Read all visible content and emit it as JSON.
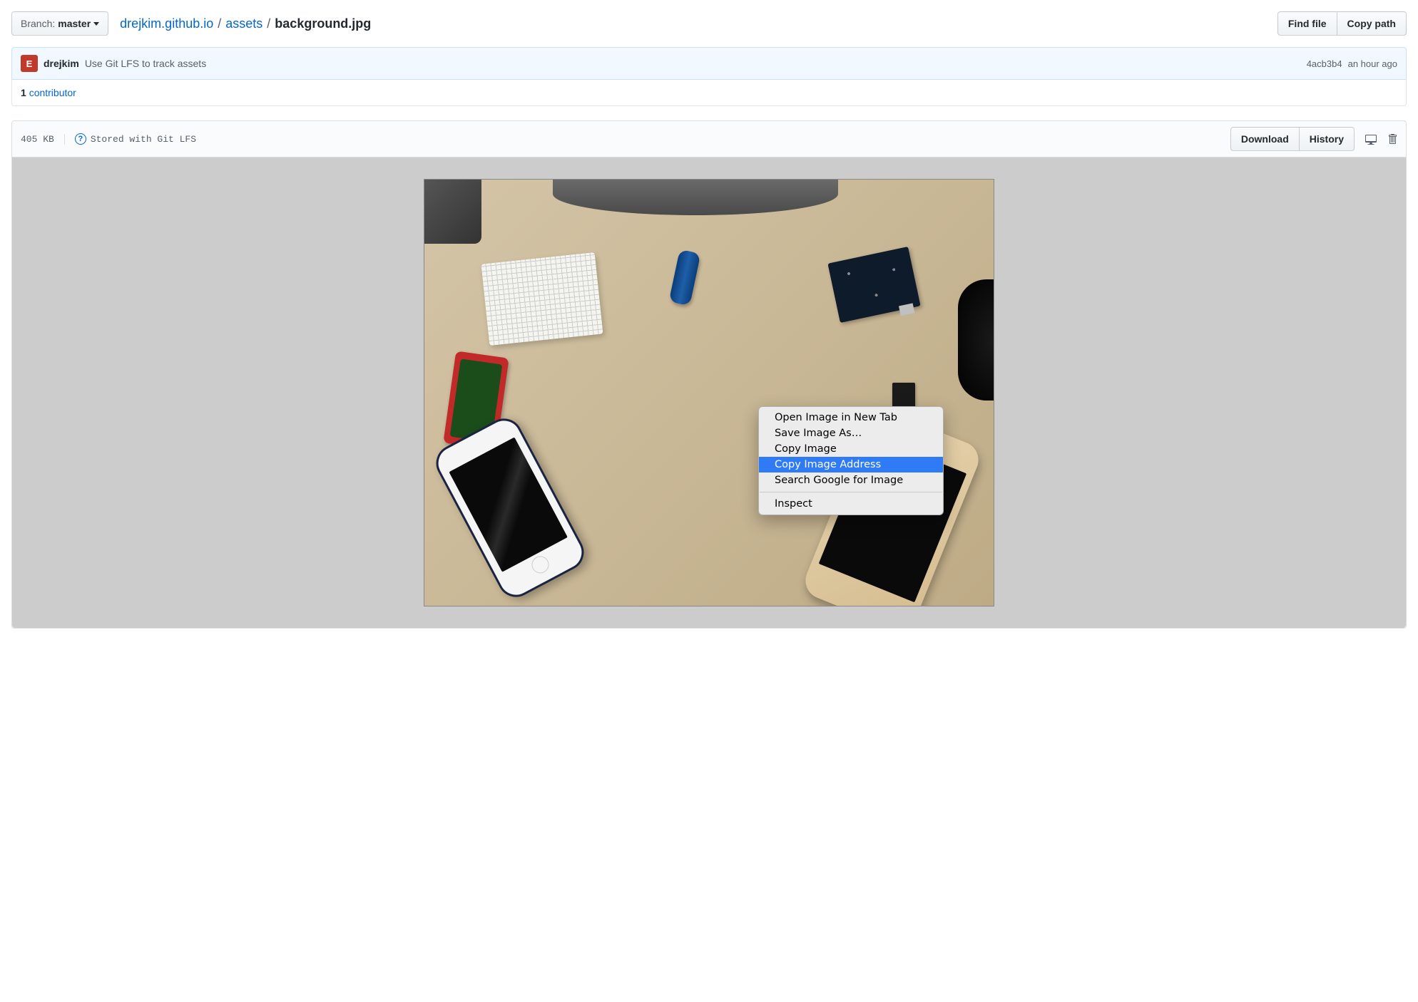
{
  "branch": {
    "label": "Branch:",
    "name": "master"
  },
  "breadcrumb": {
    "repo": "drejkim.github.io",
    "folder": "assets",
    "file": "background.jpg"
  },
  "actions": {
    "find_file": "Find file",
    "copy_path": "Copy path"
  },
  "commit": {
    "avatar_letter": "E",
    "author": "drejkim",
    "message": "Use Git LFS to track assets",
    "sha": "4acb3b4",
    "time": "an hour ago"
  },
  "contributors": {
    "count": "1",
    "label": "contributor"
  },
  "file": {
    "size": "405 KB",
    "lfs_text": "Stored with Git LFS",
    "download": "Download",
    "history": "History"
  },
  "context_menu": {
    "items": [
      "Open Image in New Tab",
      "Save Image As…",
      "Copy Image",
      "Copy Image Address",
      "Search Google for Image"
    ],
    "inspect": "Inspect",
    "highlighted_index": 3
  }
}
